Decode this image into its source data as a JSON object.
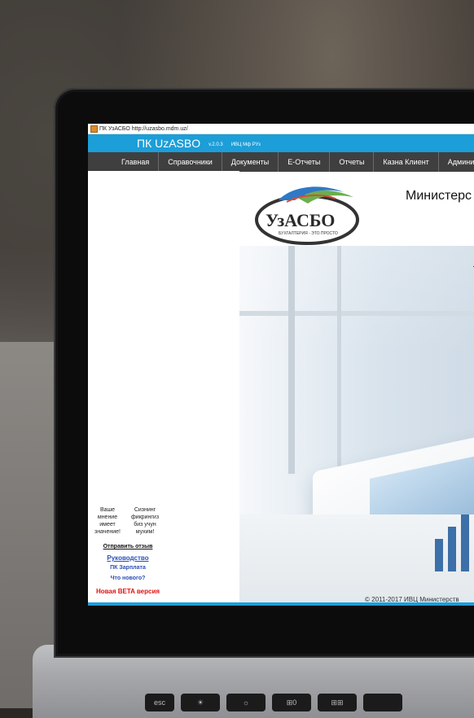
{
  "window": {
    "title": "ПК УзАСБО http://uzasbo.mdm.uz/"
  },
  "app": {
    "title": "ПК UzASBO",
    "version": "v.2.0.3",
    "org": "ИВЦ Мф РУз"
  },
  "menu": {
    "items": [
      {
        "label": "Главная"
      },
      {
        "label": "Справочники"
      },
      {
        "label": "Документы"
      },
      {
        "label": "E-Отчеты"
      },
      {
        "label": "Отчеты"
      },
      {
        "label": "Казна Клиент"
      },
      {
        "label": "Администри"
      }
    ]
  },
  "logo": {
    "text": "УзАСБО",
    "tagline": "БУХГАЛТЕРИЯ - ЭТО ПРОСТО"
  },
  "main": {
    "ministry": "Министерс",
    "bullet": "·"
  },
  "feedback": {
    "ru_text": "Ваше мнение имеет значение!",
    "uz_text": "Сизнинг фикрингиз биз учун мухим!",
    "send_link": "Отправить отзыв",
    "guide_link": "Руководство",
    "payroll_link": "ПК Зарплата",
    "whats_new_link": "Что нового?",
    "beta_link": "Новая BETA версия"
  },
  "footer": {
    "copyright": "© 2011-2017 ИВЦ Министерств"
  },
  "keyboard": {
    "keys": [
      "esc",
      "☀",
      "☼",
      "⊞0",
      "⊞⊞",
      "",
      ""
    ]
  },
  "colors": {
    "appbar": "#1c9ed8",
    "menubar": "#3f3f3f",
    "beta": "#e01414",
    "link": "#2a4fb5"
  }
}
